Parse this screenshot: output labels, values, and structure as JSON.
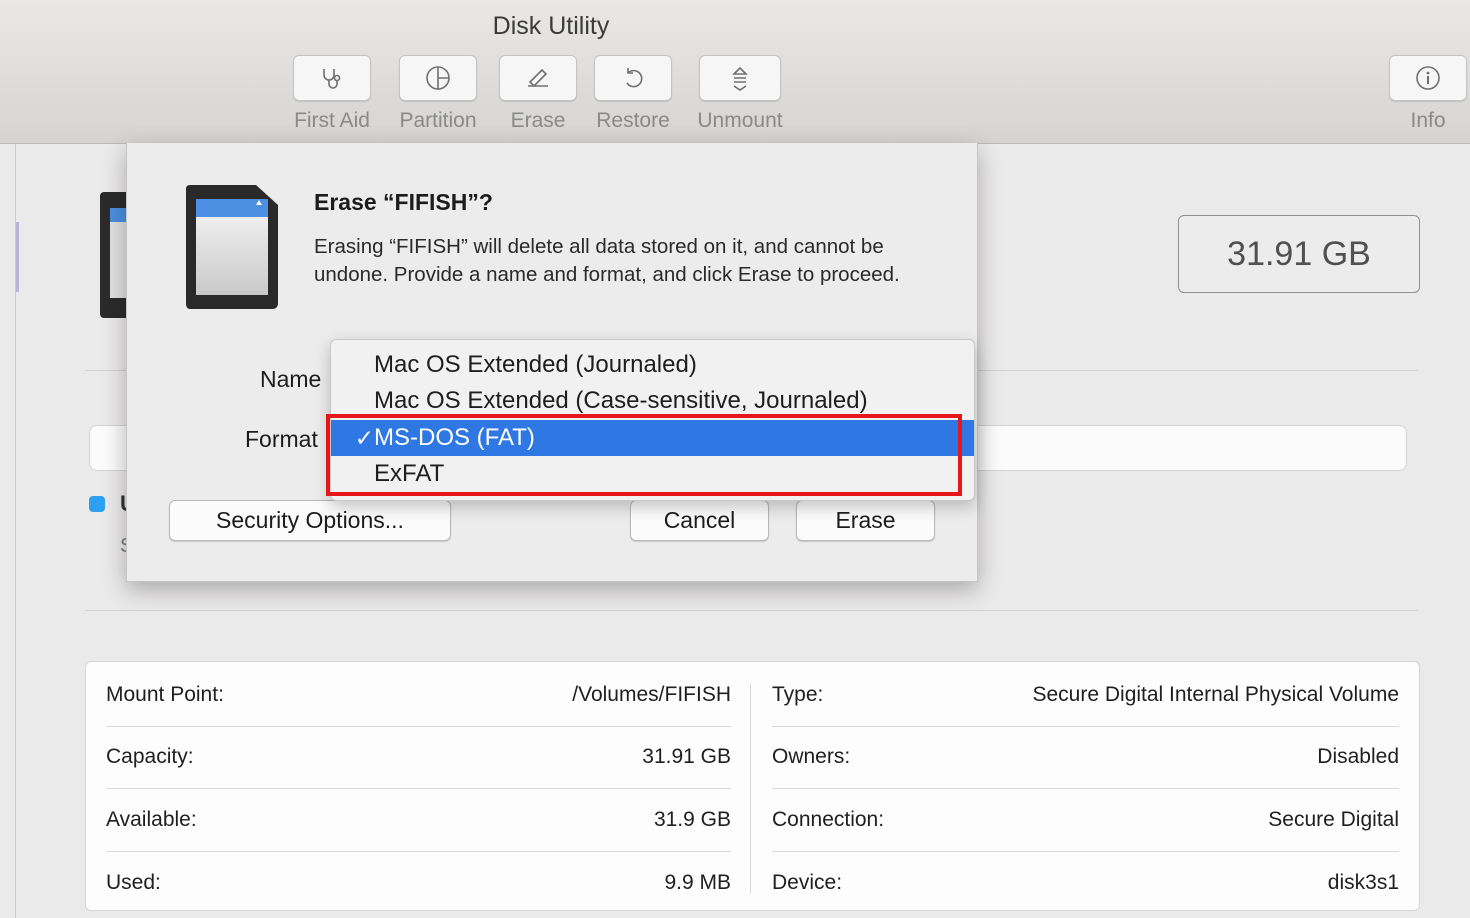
{
  "window": {
    "title": "Disk Utility"
  },
  "toolbar": {
    "buttons": [
      {
        "label": "First Aid",
        "icon": "stethoscope-icon"
      },
      {
        "label": "Partition",
        "icon": "pie-chart-icon"
      },
      {
        "label": "Erase",
        "icon": "pencil-note-icon"
      },
      {
        "label": "Restore",
        "icon": "undo-arrow-icon"
      },
      {
        "label": "Unmount",
        "icon": "eject-icon"
      }
    ],
    "info": {
      "label": "Info",
      "icon": "info-icon"
    }
  },
  "volume": {
    "capacity_display": "31.91 GB"
  },
  "legend": {
    "label": "U",
    "sub": "S"
  },
  "dialog": {
    "title": "Erase “FIFISH”?",
    "message": "Erasing “FIFISH” will delete all data stored on it, and cannot be undone. Provide a name and format, and click Erase to proceed.",
    "name_label": "Name",
    "format_label": "Format",
    "format_menu": {
      "options": [
        "Mac OS Extended (Journaled)",
        "Mac OS Extended (Case-sensitive, Journaled)",
        "MS-DOS (FAT)",
        "ExFAT"
      ],
      "selected": "MS-DOS (FAT)",
      "check_mark": "✓"
    },
    "buttons": {
      "security": "Security Options...",
      "cancel": "Cancel",
      "erase": "Erase"
    }
  },
  "info_table": {
    "left": [
      {
        "label": "Mount Point:",
        "value": "/Volumes/FIFISH"
      },
      {
        "label": "Capacity:",
        "value": "31.91 GB"
      },
      {
        "label": "Available:",
        "value": "31.9 GB"
      },
      {
        "label": "Used:",
        "value": "9.9 MB"
      }
    ],
    "right": [
      {
        "label": "Type:",
        "value": "Secure Digital Internal Physical Volume"
      },
      {
        "label": "Owners:",
        "value": "Disabled"
      },
      {
        "label": "Connection:",
        "value": "Secure Digital"
      },
      {
        "label": "Device:",
        "value": "disk3s1"
      }
    ]
  },
  "colors": {
    "selection": "#2f78e4",
    "highlight_annotation": "#e6161b",
    "legend_used": "#2f9ff0"
  }
}
